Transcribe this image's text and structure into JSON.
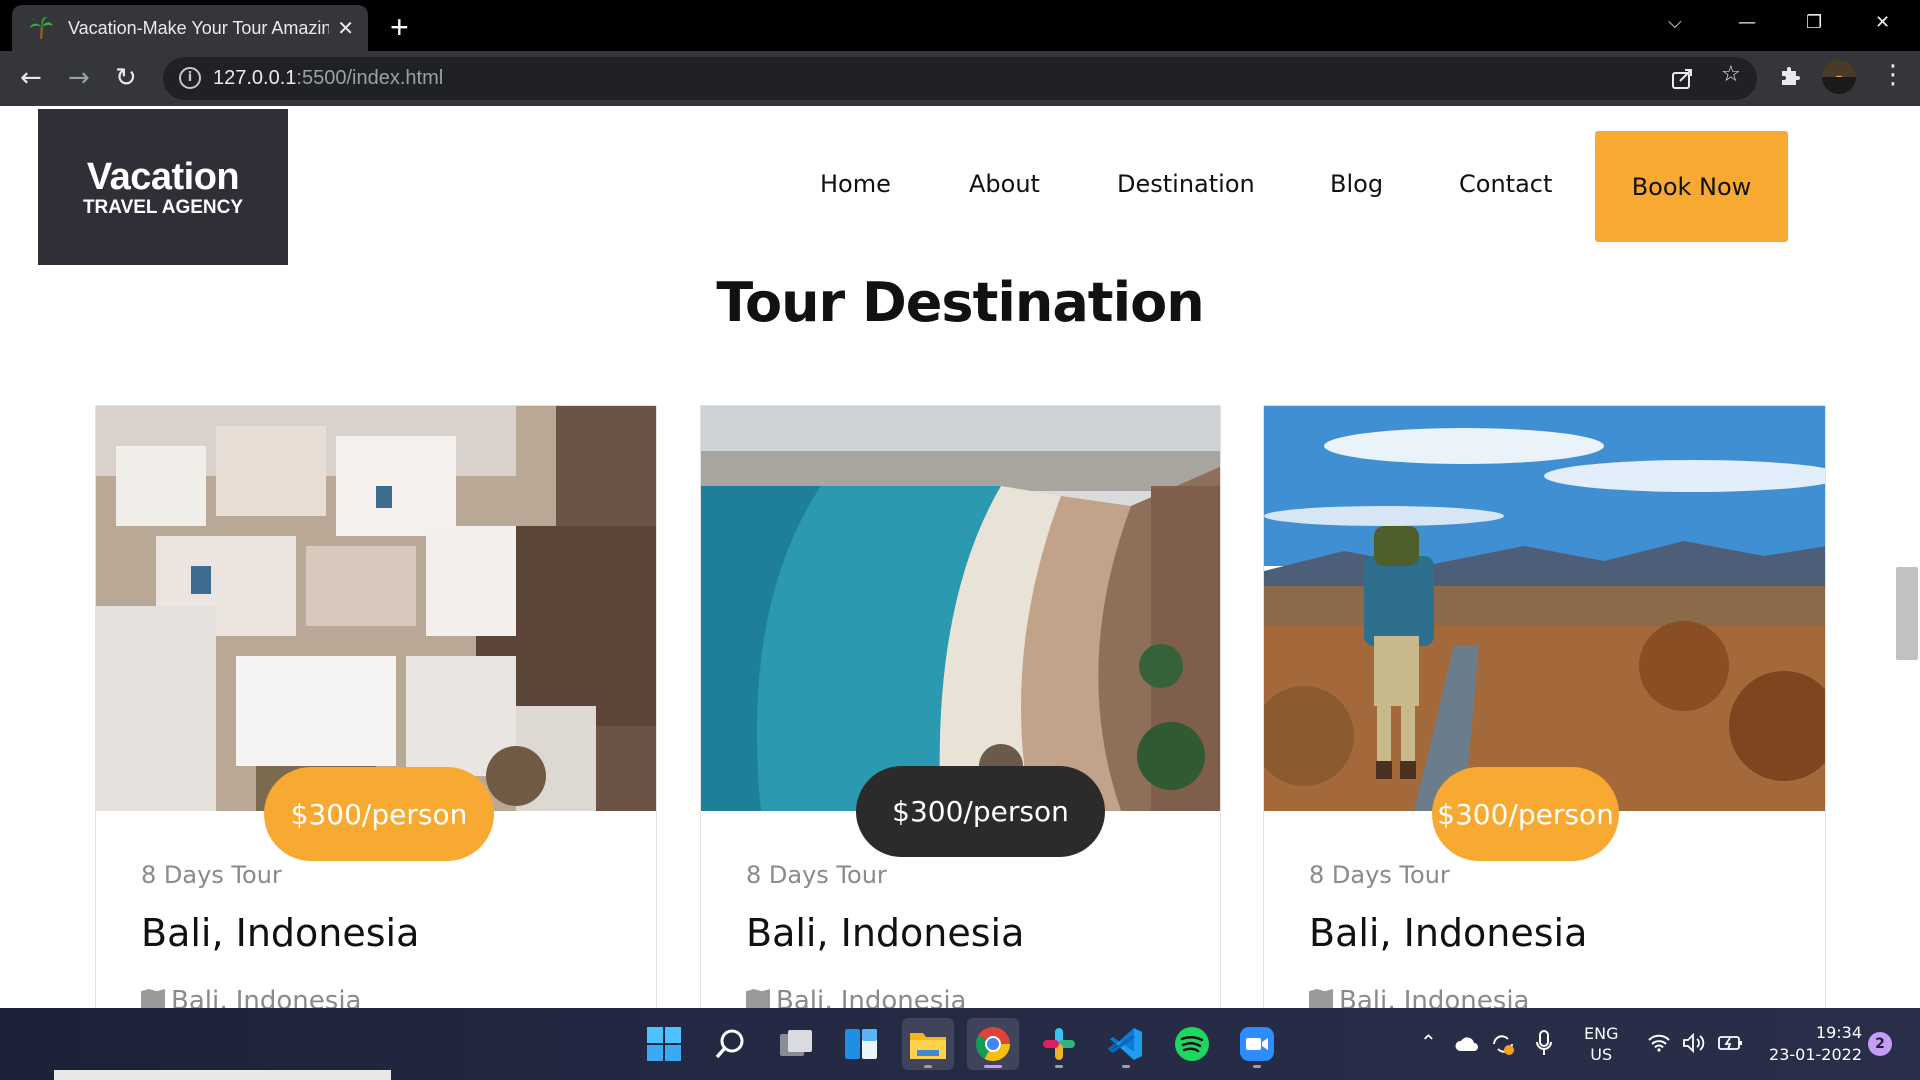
{
  "browser": {
    "tab_title": "Vacation-Make Your Tour Amazing",
    "tab_close": "✕",
    "new_tab": "+",
    "url_host": "127.0.0.1",
    "url_rest": ":5500/index.html",
    "win_dropdown": "⌵",
    "win_min": "—",
    "win_restore": "❐",
    "win_close": "✕"
  },
  "site": {
    "logo_title": "Vacation",
    "logo_subtitle": "TRAVEL AGENCY",
    "nav": [
      "Home",
      "About",
      "Destination",
      "Blog",
      "Contact"
    ],
    "cta": "Book Now",
    "section_title": "Tour Destination"
  },
  "cards": [
    {
      "price": "$300/person",
      "days": "8 Days Tour",
      "place": "Bali, Indonesia",
      "location": "Bali, Indonesia",
      "price_style": "accent"
    },
    {
      "price": "$300/person",
      "days": "8 Days Tour",
      "place": "Bali, Indonesia",
      "location": "Bali, Indonesia",
      "price_style": "dark"
    },
    {
      "price": "$300/person",
      "days": "8 Days Tour",
      "place": "Bali, Indonesia",
      "location": "Bali, Indonesia",
      "price_style": "accent"
    }
  ],
  "colors": {
    "accent": "#f8a931",
    "dark": "#2b2b2b",
    "logo_bg": "#302f37"
  },
  "taskbar": {
    "apps": [
      "windows-start",
      "search",
      "task-view",
      "widgets",
      "file-explorer",
      "chrome",
      "slack",
      "vscode",
      "spotify",
      "zoom"
    ],
    "lang_line1": "ENG",
    "lang_line2": "US",
    "time": "19:34",
    "date": "23-01-2022",
    "notification_count": "2"
  }
}
